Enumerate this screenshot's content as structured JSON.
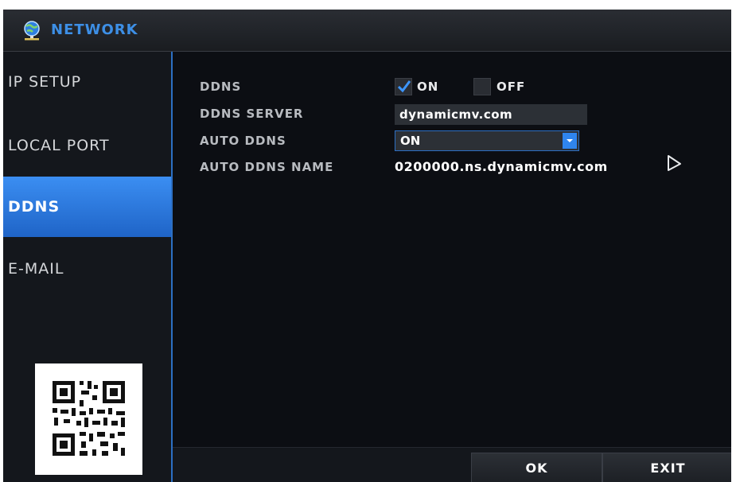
{
  "window": {
    "title": "NETWORK",
    "title_icon": "network-globe-icon",
    "accent_color": "#2c6fc3"
  },
  "sidebar": {
    "items": [
      {
        "label": "IP SETUP",
        "active": false
      },
      {
        "label": "LOCAL PORT",
        "active": false
      },
      {
        "label": "DDNS",
        "active": true
      },
      {
        "label": "E-MAIL",
        "active": false
      }
    ],
    "qr_icon": "qr-code-icon"
  },
  "form": {
    "ddns": {
      "label": "DDNS",
      "on_label": "ON",
      "off_label": "OFF",
      "selected": "ON"
    },
    "ddns_server": {
      "label": "DDNS SERVER",
      "value": "dynamicmv.com"
    },
    "auto_ddns": {
      "label": "AUTO DDNS",
      "value": "ON"
    },
    "auto_ddns_name": {
      "label": "AUTO DDNS NAME",
      "value": "0200000.ns.dynamicmv.com"
    }
  },
  "footer": {
    "ok_label": "OK",
    "exit_label": "EXIT"
  }
}
